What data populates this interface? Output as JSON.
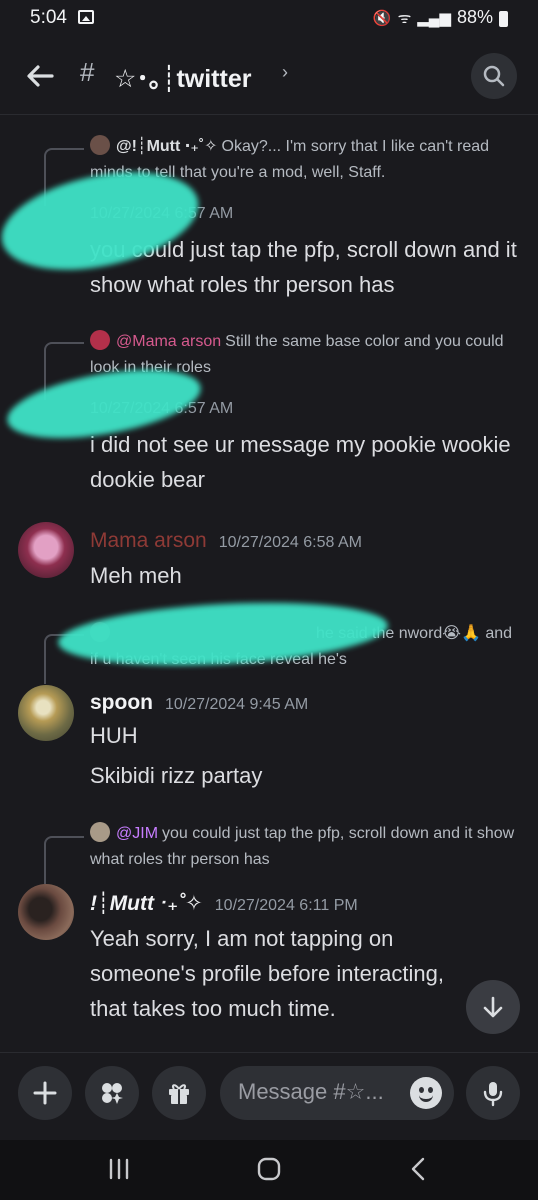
{
  "status_bar": {
    "time": "5:04",
    "battery": "88%"
  },
  "header": {
    "hash": "#",
    "channel_name": "☆･｡┊twitter",
    "chevron": "›"
  },
  "messages": [
    {
      "reply": {
        "author": "@!┊Mutt ‧₊˚✧",
        "text": "Okay?... I'm sorry that I like can't read minds to tell that you're a mod, well, Staff."
      },
      "timestamp": "10/27/2024 6:57 AM",
      "text": "you could just tap the pfp, scroll down and it show what roles thr person has"
    },
    {
      "reply": {
        "author": "@Mama arson",
        "text": "Still the same base color and you could look in their roles"
      },
      "timestamp": "10/27/2024 6:57 AM",
      "text": "i did not see ur message my pookie wookie dookie bear"
    },
    {
      "author": "Mama arson",
      "timestamp": "10/27/2024 6:58 AM",
      "text": "Meh meh"
    },
    {
      "reply": {
        "text": "he said the nword😭🙏 and if u haven't seen his face reveal he's"
      },
      "author": "spoon",
      "timestamp": "10/27/2024 9:45 AM",
      "text": "HUH",
      "text2": "Skibidi rizz partay"
    },
    {
      "reply": {
        "author": "@JIM",
        "text": "you could just tap the pfp, scroll down and it show what roles thr person has"
      },
      "author": "!┊Mutt ‧₊˚✧",
      "timestamp": "10/27/2024 6:11 PM",
      "text": "Yeah sorry, I am not tapping on someone's profile before interacting, that takes too much time."
    }
  ],
  "composer": {
    "placeholder": "Message #☆..."
  },
  "colors": {
    "background": "#1a1a1e",
    "redaction": "#3fe3c7",
    "mama_arson": "#8e3a36"
  }
}
